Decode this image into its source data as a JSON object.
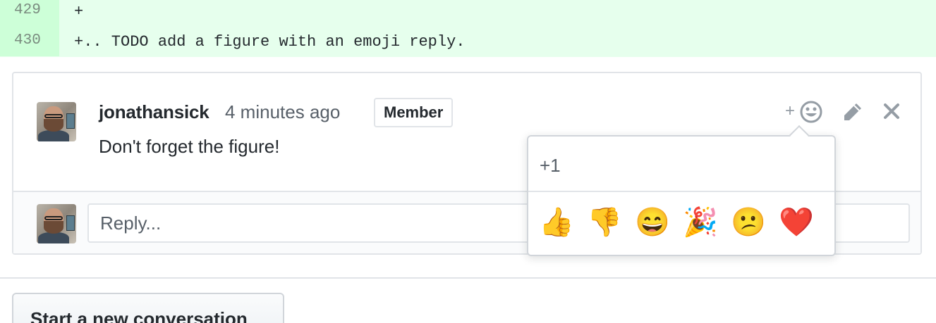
{
  "diff": {
    "lines": [
      {
        "number": "429",
        "code": "+"
      },
      {
        "number": "430",
        "code": "+.. TODO add a figure with an emoji reply."
      }
    ]
  },
  "comment": {
    "author": "jonathansick",
    "timestamp": "4 minutes ago",
    "badge": "Member",
    "body": "Don't forget the figure!",
    "add_reaction_plus": "+",
    "icons": {
      "add_reaction": "smiley-icon",
      "edit": "pencil-icon",
      "delete": "close-icon"
    }
  },
  "reply": {
    "placeholder": "Reply..."
  },
  "reaction_popover": {
    "title": "+1",
    "emojis": [
      {
        "name": "thumbs-up",
        "glyph": "👍"
      },
      {
        "name": "thumbs-down",
        "glyph": "👎"
      },
      {
        "name": "laugh",
        "glyph": "😄"
      },
      {
        "name": "hooray",
        "glyph": "🎉"
      },
      {
        "name": "confused",
        "glyph": "😕"
      },
      {
        "name": "heart",
        "glyph": "❤️"
      }
    ]
  },
  "footer": {
    "new_conversation_label": "Start a new conversation"
  },
  "colors": {
    "diff_added_bg": "#e6ffed",
    "diff_added_num_bg": "#cdffd8",
    "border": "#e1e4e8",
    "muted_text": "#586069",
    "icon_gray": "#959da5"
  }
}
